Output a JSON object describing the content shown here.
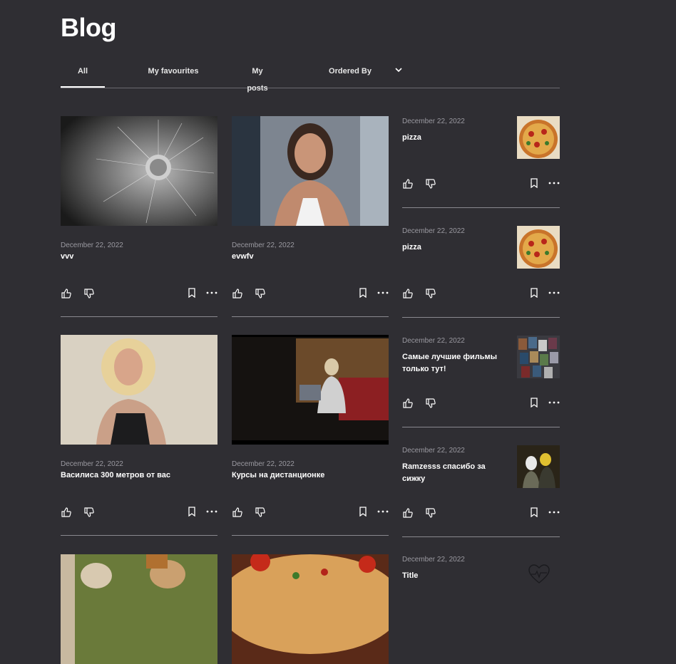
{
  "page": {
    "title": "Blog"
  },
  "tabs": {
    "all": "All",
    "favourites": "My favourites",
    "posts": "My posts",
    "ordered_by": "Ordered By"
  },
  "grid_cards": [
    {
      "date": "December 22, 2022",
      "title": "vvv",
      "image": "dandelion-photo"
    },
    {
      "date": "December 22, 2022",
      "title": "evwfv",
      "image": "woman-portrait-photo"
    },
    {
      "date": "December 22, 2022",
      "title": "Василиса 300 метров от вас",
      "image": "blonde-woman-photo"
    },
    {
      "date": "December 22, 2022",
      "title": "Курсы на дистанционке",
      "image": "man-laptop-photo"
    },
    {
      "date": "",
      "title": "",
      "image": "people-photo"
    },
    {
      "date": "",
      "title": "",
      "image": "pizza-photo"
    }
  ],
  "side_posts": [
    {
      "date": "December 22, 2022",
      "title": "pizza",
      "image": "pizza-thumb"
    },
    {
      "date": "December 22, 2022",
      "title": "pizza",
      "image": "pizza-thumb"
    },
    {
      "date": "December 22, 2022",
      "title": "Самые лучшие фильмы только тут!",
      "image": "movies-thumb"
    },
    {
      "date": "December 22, 2022",
      "title": "Ramzesss спасибо за сижку",
      "image": "people-thumb"
    },
    {
      "date": "December 22, 2022",
      "title": "Title",
      "image": "heart-placeholder-icon"
    }
  ],
  "colors": {
    "background": "#2f2e33",
    "text": "#ffffff",
    "muted": "#9a99a0",
    "divider": "#8a898f"
  }
}
